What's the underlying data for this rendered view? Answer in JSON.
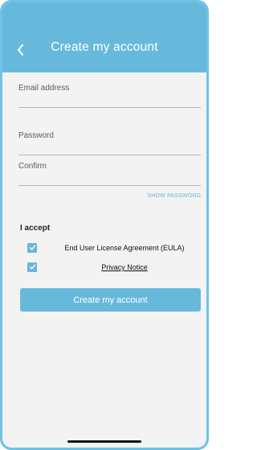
{
  "header": {
    "title": "Create my account",
    "back_icon": "chevron-left-icon"
  },
  "form": {
    "email_label": "Email address",
    "password_label": "Password",
    "confirm_label": "Confirm",
    "show_password": "SHOW PASSWORD"
  },
  "accept": {
    "heading": "I accept",
    "items": [
      {
        "label": "End User License Agreement (EULA)",
        "checked": true
      },
      {
        "label": "Privacy Notice",
        "checked": true
      }
    ]
  },
  "submit": {
    "label": "Create my account"
  },
  "colors": {
    "accent": "#67b9dc",
    "frame": "#6ec3e6",
    "background": "#f3f3f3"
  }
}
